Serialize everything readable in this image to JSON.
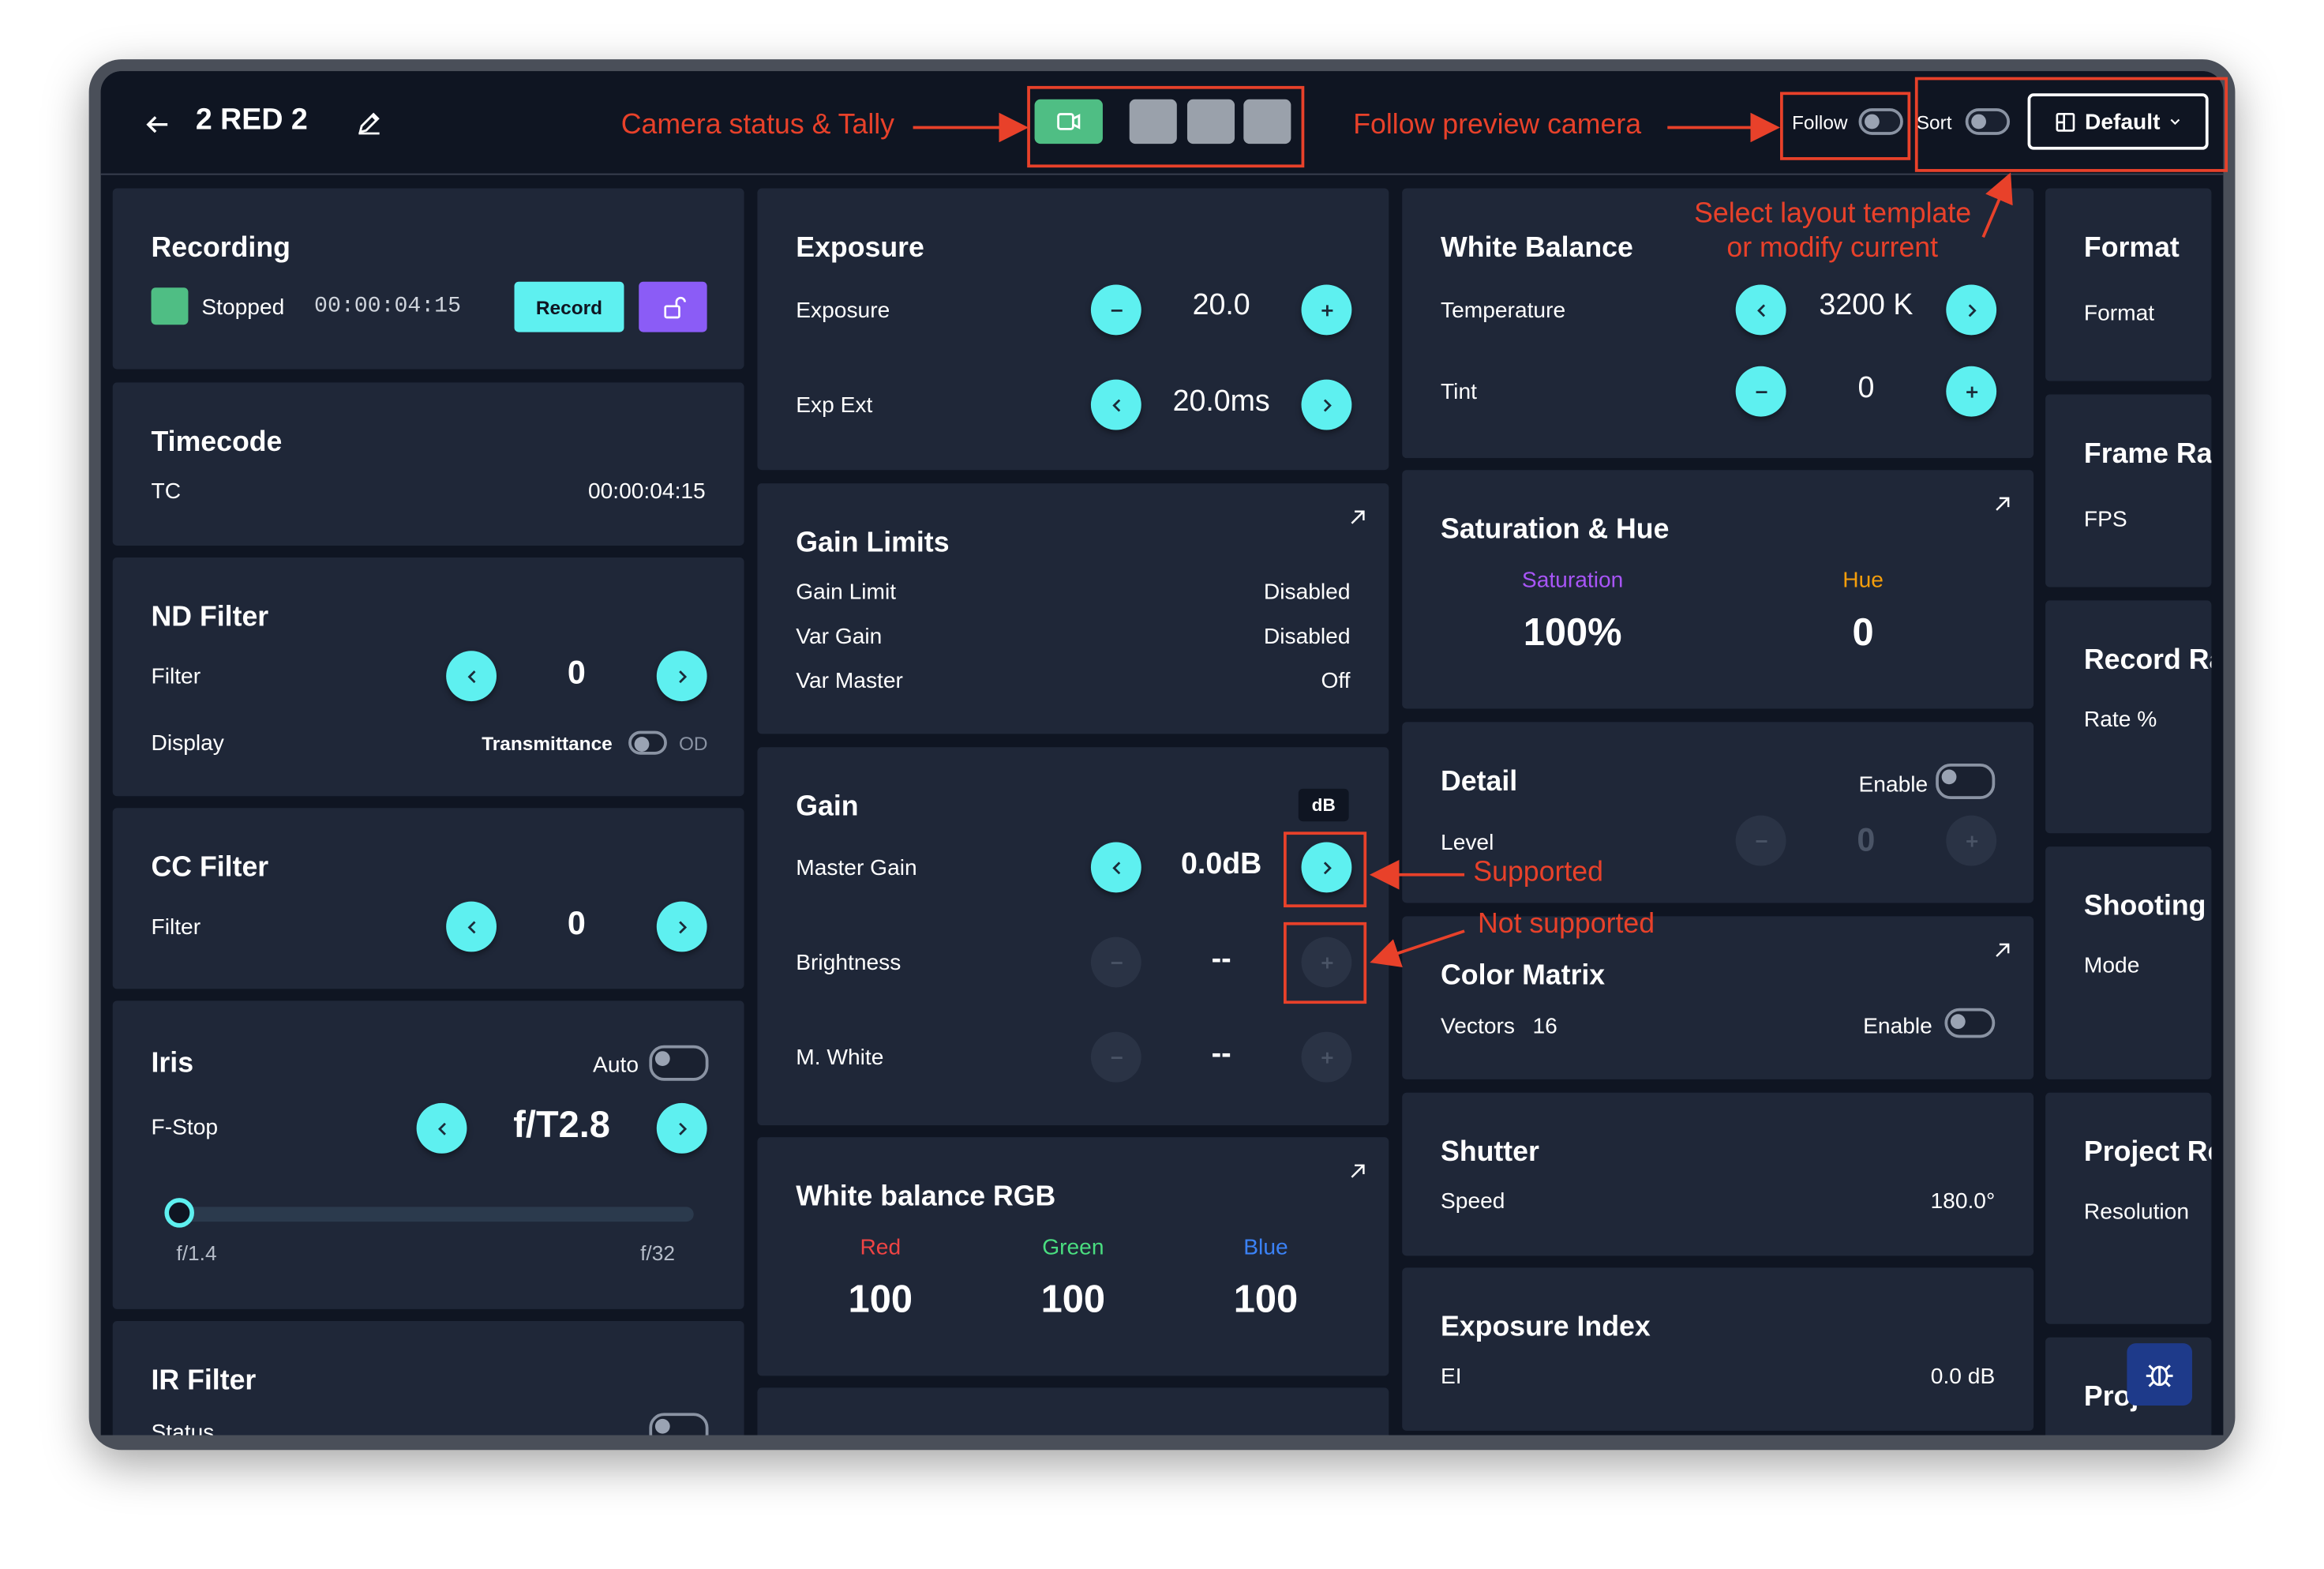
{
  "header": {
    "title": "2 RED 2",
    "follow_label": "Follow",
    "sort_label": "Sort",
    "layout_button": "Default"
  },
  "annotations": {
    "camera_status": "Camera status & Tally",
    "follow_preview": "Follow preview camera",
    "select_layout_line1": "Select layout template",
    "select_layout_line2": "or modify current",
    "supported": "Supported",
    "not_supported": "Not supported"
  },
  "recording": {
    "title": "Recording",
    "status": "Stopped",
    "timecode": "00:00:04:15",
    "record_label": "Record"
  },
  "timecode": {
    "title": "Timecode",
    "label": "TC",
    "value": "00:00:04:15"
  },
  "nd_filter": {
    "title": "ND Filter",
    "filter_label": "Filter",
    "filter_value": "0",
    "display_label": "Display",
    "transmittance_label": "Transmittance",
    "od_label": "OD"
  },
  "cc_filter": {
    "title": "CC Filter",
    "filter_label": "Filter",
    "filter_value": "0"
  },
  "iris": {
    "title": "Iris",
    "auto_label": "Auto",
    "fstop_label": "F-Stop",
    "fstop_value": "f/T2.8",
    "min_label": "f/1.4",
    "max_label": "f/32",
    "slider_position": 0.0
  },
  "ir_filter": {
    "title": "IR Filter",
    "status_label": "Status"
  },
  "exposure": {
    "title": "Exposure",
    "exposure_label": "Exposure",
    "exposure_value": "20.0",
    "expext_label": "Exp Ext",
    "expext_value": "20.0ms"
  },
  "gain_limits": {
    "title": "Gain Limits",
    "rows": [
      {
        "label": "Gain Limit",
        "value": "Disabled"
      },
      {
        "label": "Var Gain",
        "value": "Disabled"
      },
      {
        "label": "Var Master",
        "value": "Off"
      }
    ]
  },
  "gain": {
    "title": "Gain",
    "unit_badge": "dB",
    "master_label": "Master Gain",
    "master_value": "0.0dB",
    "brightness_label": "Brightness",
    "brightness_value": "--",
    "mwhite_label": "M. White",
    "mwhite_value": "--"
  },
  "wb_rgb": {
    "title": "White balance RGB",
    "red_label": "Red",
    "red_value": "100",
    "green_label": "Green",
    "green_value": "100",
    "blue_label": "Blue",
    "blue_value": "100"
  },
  "white_balance": {
    "title": "White Balance",
    "temp_label": "Temperature",
    "temp_value": "3200 K",
    "tint_label": "Tint",
    "tint_value": "0"
  },
  "sat_hue": {
    "title": "Saturation & Hue",
    "sat_label": "Saturation",
    "sat_value": "100%",
    "hue_label": "Hue",
    "hue_value": "0"
  },
  "detail": {
    "title": "Detail",
    "enable_label": "Enable",
    "level_label": "Level",
    "level_value": "0"
  },
  "color_matrix": {
    "title": "Color Matrix",
    "vectors_label": "Vectors",
    "vectors_value": "16",
    "enable_label": "Enable"
  },
  "shutter": {
    "title": "Shutter",
    "speed_label": "Speed",
    "speed_value": "180.0°"
  },
  "exposure_index": {
    "title": "Exposure Index",
    "ei_label": "EI",
    "ei_value": "0.0 dB"
  },
  "right_column": [
    {
      "title": "Format",
      "label": "Format"
    },
    {
      "title": "Frame Ra",
      "label": "FPS"
    },
    {
      "title": "Record Ra",
      "label": "Rate %"
    },
    {
      "title": "Shooting",
      "label": "Mode"
    },
    {
      "title": "Project Re",
      "label": "Resolution"
    },
    {
      "title": "Proj",
      "label": ""
    }
  ],
  "colors": {
    "accent": "#5ef0f0",
    "card": "#1f2738",
    "background": "#0f1522",
    "annotation": "#e8412a",
    "live_tally": "#4fbe84",
    "lock_button": "#8b5cf6",
    "saturation": "#a855f7",
    "hue": "#f59e0b",
    "red": "#ef4444",
    "green": "#4ade80",
    "blue": "#3b82f6"
  }
}
